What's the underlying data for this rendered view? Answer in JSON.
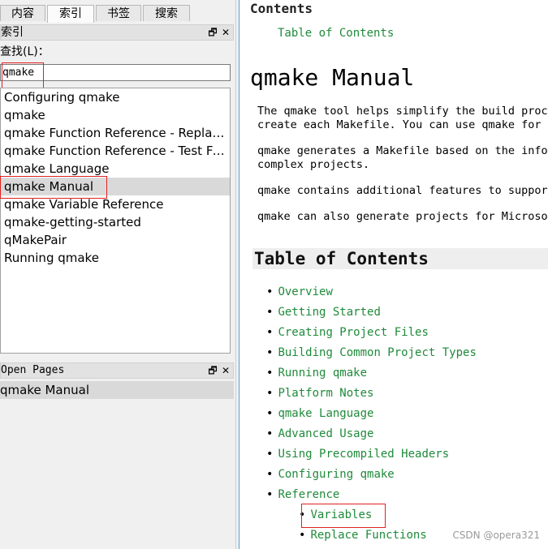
{
  "tabs": [
    {
      "label": "内容",
      "active": false
    },
    {
      "label": "索引",
      "active": true
    },
    {
      "label": "书签",
      "active": false
    },
    {
      "label": "搜索",
      "active": false
    }
  ],
  "index_panel": {
    "title": "索引",
    "find_label": "查找(L)：",
    "find_value": "qmake",
    "items": [
      "Configuring qmake",
      "qmake",
      "qmake Function Reference - Replac...",
      "qmake Function Reference - Test Fu...",
      "qmake Language",
      "qmake Manual",
      "qmake Variable Reference",
      "qmake-getting-started",
      "qMakePair",
      "Running qmake"
    ],
    "selected": "qmake Manual"
  },
  "open_pages": {
    "title": "Open Pages",
    "items": [
      "qmake Manual"
    ]
  },
  "dock_buttons": {
    "float": "🗗",
    "close": "✕"
  },
  "document": {
    "header": "Contents",
    "top_link": "Table of Contents",
    "title": "qmake Manual",
    "paragraphs": [
      "The qmake tool helps simplify the build proce\ncreate each Makefile. You can use qmake for a",
      "qmake generates a Makefile based on the infor\ncomplex projects.",
      "qmake contains additional features to support",
      "qmake can also generate projects for Microsof"
    ],
    "toc_heading": "Table of Contents",
    "toc": [
      {
        "label": "Overview",
        "level": 1
      },
      {
        "label": "Getting Started",
        "level": 1
      },
      {
        "label": "Creating Project Files",
        "level": 1
      },
      {
        "label": "Building Common Project Types",
        "level": 1
      },
      {
        "label": "Running qmake",
        "level": 1
      },
      {
        "label": "Platform Notes",
        "level": 1
      },
      {
        "label": "qmake Language",
        "level": 1
      },
      {
        "label": "Advanced Usage",
        "level": 1
      },
      {
        "label": "Using Precompiled Headers",
        "level": 1
      },
      {
        "label": "Configuring qmake",
        "level": 1
      },
      {
        "label": "Reference",
        "level": 1
      },
      {
        "label": "Variables",
        "level": 2
      },
      {
        "label": "Replace Functions",
        "level": 2
      }
    ]
  },
  "watermark": "CSDN @opera321",
  "colors": {
    "link": "#1f8a3a",
    "highlight": "#e02020",
    "selection": "#d9d9d9"
  }
}
